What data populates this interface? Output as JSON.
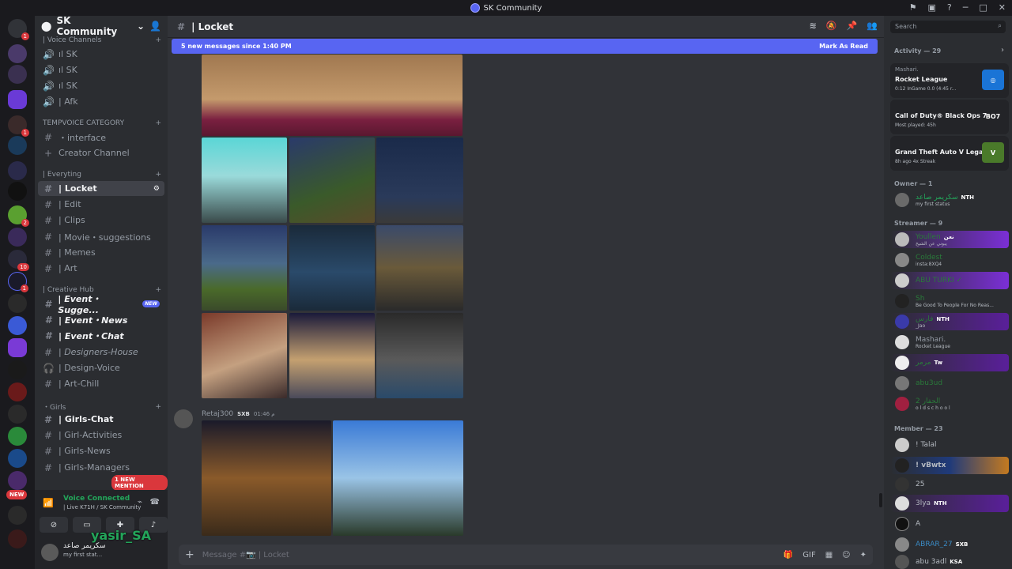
{
  "window": {
    "title": "SK Community"
  },
  "server": {
    "name": "SK Community"
  },
  "rail": {
    "new_label": "NEW"
  },
  "channels": {
    "voice_category": "| Voice Channels",
    "voice": [
      "ıl SK",
      "ıl SK",
      "ıl SK",
      "| Afk"
    ],
    "tempvoice_category": "TEMPVOICE CATEGORY",
    "tempvoice": [
      "・interface",
      "Creator Channel"
    ],
    "everything_category": "| Everyting",
    "everything": [
      "| Locket",
      "| Edit",
      "| Clips",
      "| Movie・suggestions",
      "| Memes",
      "| Art"
    ],
    "creative_category": "| Creative Hub",
    "creative": [
      "| Event・Sugge...",
      "| Event・News",
      "| Event・Chat",
      "| Designers-House",
      "| Design-Voice",
      "| Art-Chill"
    ],
    "creative_new_badge": "NEW",
    "girls_category": "・Girls",
    "girls": [
      "| Girls-Chat",
      "| Girl-Activities",
      "| Girls-News",
      "| Girls-Managers"
    ],
    "mention_badge": "1 NEW MENTION"
  },
  "voice": {
    "status": "Voice Connected",
    "detail": "| Live K71H / SK Community"
  },
  "user": {
    "name": "سكريمر صاعد",
    "status": "my first stat...",
    "overlay": "yasir_SA"
  },
  "main": {
    "channel": "| Locket",
    "new_messages": "5 new messages since 1:40 PM",
    "mark_read": "Mark As Read",
    "message": {
      "author": "Retaj300",
      "tag": "SXB",
      "time": "01:46 م"
    },
    "input_placeholder": "Message #📷 | Locket"
  },
  "members": {
    "search_placeholder": "Search",
    "activity_header": "Activity — 29",
    "activities": [
      {
        "user": "Mashari.",
        "game": "Rocket League",
        "detail": "0:12  InGame 0.0 (4:45 r...",
        "color": "#1a74d6"
      },
      {
        "user": "",
        "game": "Call of Duty® Black Ops 7",
        "detail": "Most played: 45h",
        "logo": "BO7",
        "color": "#232428"
      },
      {
        "user": "",
        "game": "Grand Theft Auto V Legacy",
        "detail": "8h ago  4x Streak",
        "logo": "V",
        "color": "#4a7a2a"
      }
    ],
    "owner_header": "Owner — 1",
    "owner": {
      "name": "سكريمر صاعد",
      "tag": "NTH",
      "status": "my first status"
    },
    "streamer_header": "Streamer — 9",
    "streamers": [
      {
        "name": "Youllen",
        "tag": "نعن",
        "status": "يبوني عن الشيخ",
        "color": "#7b2fd6"
      },
      {
        "name": "Coldest",
        "tag": "",
        "status": "insta:8XQ4",
        "color": ""
      },
      {
        "name": "ABU TURKI ✓",
        "tag": "",
        "status": "",
        "color": "#7b2fd6"
      },
      {
        "name": "Sh",
        "tag": "",
        "status": "Be Good To People For No Reas...",
        "color": ""
      },
      {
        "name": "فارس",
        "tag": "NTH",
        "status": "_Jao",
        "color": "#5a1f9a"
      },
      {
        "name": "Mashari.",
        "tag": "",
        "status": "Rocket League",
        "color": ""
      },
      {
        "name": "مرمر",
        "tag": "Tw",
        "status": "",
        "color": "#5a1f9a"
      },
      {
        "name": "abu3ud",
        "tag": "",
        "status": "",
        "color": ""
      },
      {
        "name": "الحفار 2",
        "tag": "",
        "status": "o l d s c h o o l",
        "color": ""
      }
    ],
    "member_header": "Member — 23",
    "member_list": [
      {
        "name": "! Talal",
        "tag": "",
        "color": ""
      },
      {
        "name": "! vBwtx",
        "tag": "",
        "color": "#1f3a7a"
      },
      {
        "name": "25",
        "tag": "",
        "color": ""
      },
      {
        "name": "3lya",
        "tag": "NTH",
        "color": "#5a1f9a"
      },
      {
        "name": "A",
        "tag": "",
        "color": ""
      },
      {
        "name": "ABRAR_27",
        "tag": "SXB",
        "color": ""
      },
      {
        "name": "abu 3adl",
        "tag": "KSA",
        "color": ""
      }
    ]
  }
}
